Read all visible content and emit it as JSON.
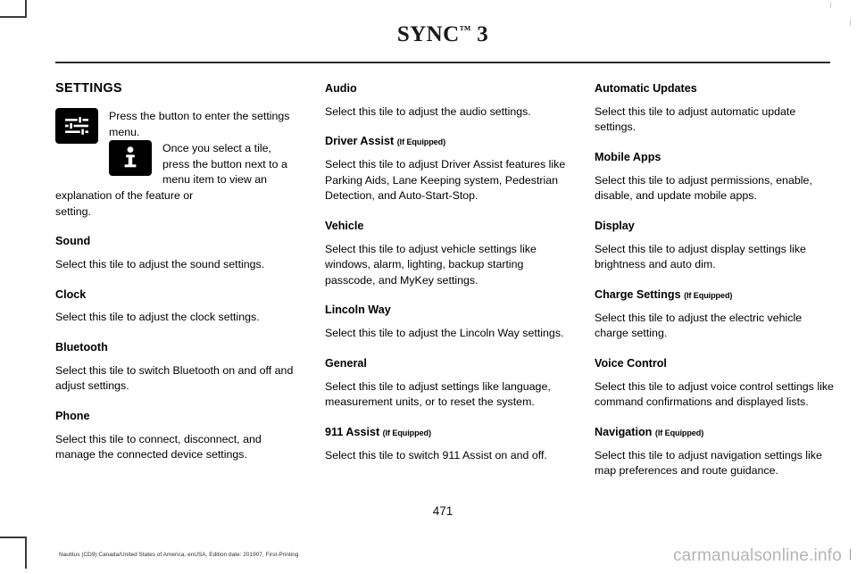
{
  "header": {
    "title_main": "SYNC",
    "title_tm": "™",
    "title_suffix": " 3"
  },
  "columns": {
    "left": {
      "section_title": "SETTINGS",
      "icon_items": [
        {
          "icon": "sliders-settings-icon",
          "text": "Press the button to enter the settings menu."
        },
        {
          "icon": "info-icon",
          "text": "Once you select a tile, press the button next to a menu item to view an explanation of the feature or",
          "tail": "setting."
        }
      ],
      "entries": [
        {
          "title": "Sound",
          "qualifier": "",
          "body": "Select this tile to adjust the sound settings."
        },
        {
          "title": "Clock",
          "qualifier": "",
          "body": "Select this tile to adjust the clock settings."
        },
        {
          "title": "Bluetooth",
          "qualifier": "",
          "body": "Select this tile to switch Bluetooth on and off and adjust settings."
        },
        {
          "title": "Phone",
          "qualifier": "",
          "body": "Select this tile to connect, disconnect, and manage the connected device settings."
        }
      ]
    },
    "middle": {
      "entries": [
        {
          "title": "Audio",
          "qualifier": "",
          "body": "Select this tile to adjust the audio settings."
        },
        {
          "title": "Driver Assist",
          "qualifier": "(If Equipped)",
          "body": "Select this tile to adjust Driver Assist features like Parking Aids, Lane Keeping system, Pedestrian Detection, and Auto-Start-Stop."
        },
        {
          "title": "Vehicle",
          "qualifier": "",
          "body": "Select this tile to adjust vehicle settings like windows, alarm, lighting, backup starting passcode, and MyKey settings."
        },
        {
          "title": "Lincoln Way",
          "qualifier": "",
          "body": "Select this tile to adjust the Lincoln Way settings."
        },
        {
          "title": "General",
          "qualifier": "",
          "body": "Select this tile to adjust settings like language, measurement units, or to reset the system."
        },
        {
          "title": "911 Assist",
          "qualifier": "(If Equipped)",
          "body": "Select this tile to switch 911 Assist on and off."
        }
      ]
    },
    "right": {
      "entries": [
        {
          "title": "Automatic Updates",
          "qualifier": "",
          "body": "Select this tile to adjust automatic update settings."
        },
        {
          "title": "Mobile Apps",
          "qualifier": "",
          "body": "Select this tile to adjust permissions, enable, disable, and update mobile apps."
        },
        {
          "title": "Display",
          "qualifier": "",
          "body": "Select this tile to adjust display settings like brightness and auto dim."
        },
        {
          "title": "Charge Settings",
          "qualifier": "(If Equipped)",
          "body": "Select this tile to adjust the electric vehicle charge setting."
        },
        {
          "title": "Voice Control",
          "qualifier": "",
          "body": "Select this tile to adjust voice control settings like command confirmations and displayed lists."
        },
        {
          "title": "Navigation",
          "qualifier": "(If Equipped)",
          "body": "Select this tile to adjust navigation settings like map preferences and route guidance."
        }
      ]
    }
  },
  "footer": {
    "page_number": "471",
    "note": "Nautilus (CD9) Canada/United States of America, enUSA, Edition date: 201907, First-Printing",
    "watermark": "carmanualsonline.info"
  },
  "colors": {
    "text": "#000000",
    "rule": "#2b2b2b",
    "icon_tile_bg": "#000000",
    "icon_tile_fg": "#ffffff",
    "watermark": "#b4b4b4"
  }
}
